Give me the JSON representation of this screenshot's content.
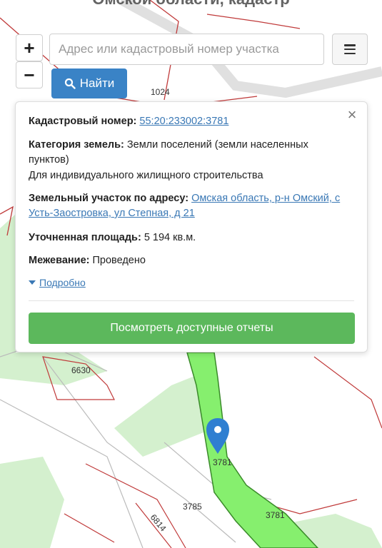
{
  "header": {
    "title": "Омской области, кадастр"
  },
  "controls": {
    "zoom_in": "+",
    "zoom_out": "−",
    "search_placeholder": "Адрес или кадастровый номер участка",
    "find_label": "Найти"
  },
  "popup": {
    "close": "×",
    "cadastral_label": "Кадастровый номер:",
    "cadastral_value": "55:20:233002:3781",
    "category_label": "Категория земель:",
    "category_value": "Земли поселений (земли населенных пунктов)",
    "usage": "Для индивидуального жилищного строительства",
    "address_label": "Земельный участок по адресу:",
    "address_value": "Омская область, р-н Омский, с Усть-Заостровка, ул Степная, д 21",
    "area_label": "Уточненная площадь:",
    "area_value": "5 194 кв.м.",
    "survey_label": "Межевание:",
    "survey_value": "Проведено",
    "more_label": "Подробно",
    "reports_button": "Посмотреть доступные отчеты"
  },
  "map": {
    "parcel_labels": [
      "1024",
      "6630",
      "3785",
      "6814",
      "3781",
      "3781"
    ],
    "colors": {
      "selected_parcel": "#86ef6e",
      "parcel_fill": "#d4f0ce",
      "boundary": "#c03a3a",
      "marker": "#2f7fd1"
    },
    "marker_icon": "map-pin-icon"
  }
}
